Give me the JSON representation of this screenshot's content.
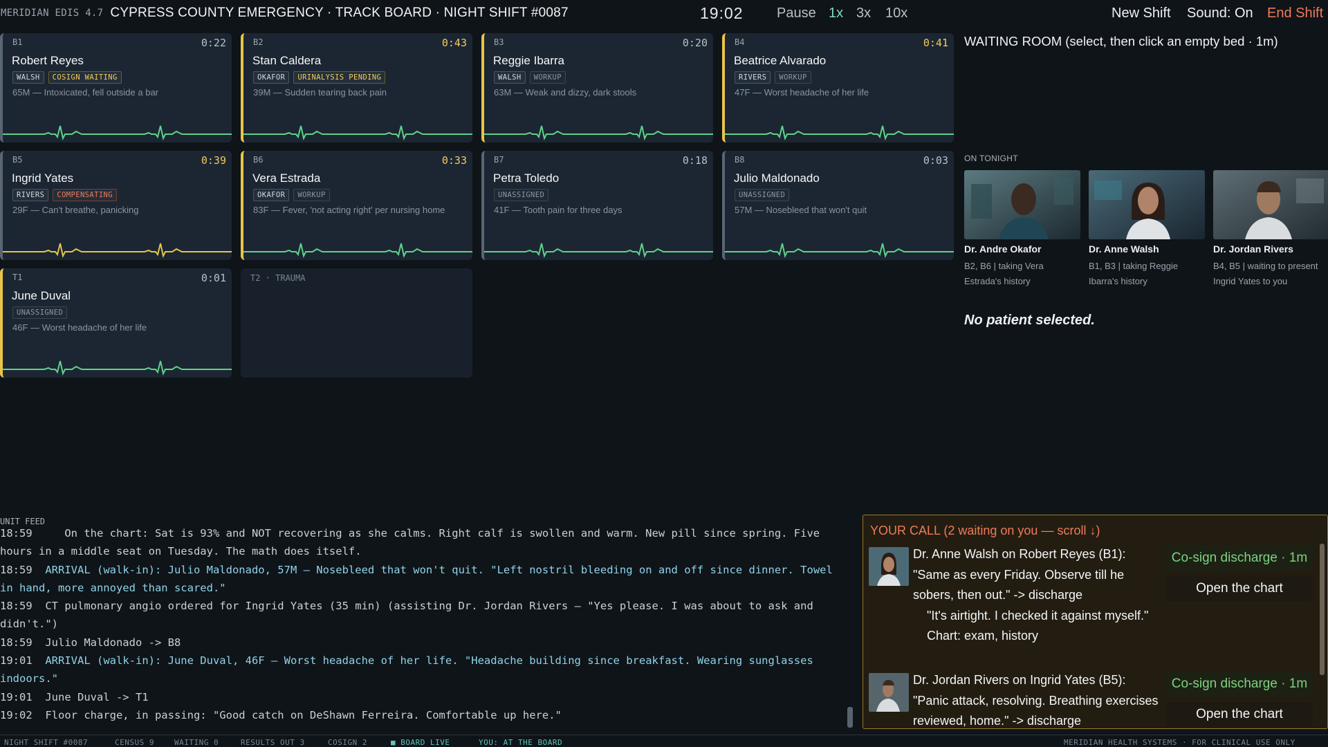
{
  "topbar": {
    "brand": "MERIDIAN EDIS 4.7",
    "title": "CYPRESS COUNTY EMERGENCY · TRACK BOARD · NIGHT SHIFT #0087",
    "clock": "19:02",
    "pause": "Pause",
    "speed_1x": "1x",
    "speed_3x": "3x",
    "speed_10x": "10x",
    "active_speed": "1x",
    "new_shift": "New Shift",
    "sound": "Sound: On",
    "end_shift": "End Shift"
  },
  "beds": [
    {
      "id": "B1",
      "timer": "0:22",
      "timer_warn": false,
      "accent": "#5a6573",
      "name": "Robert Reyes",
      "tags": [
        {
          "text": "WALSH",
          "style": "plain"
        },
        {
          "text": "COSIGN WAITING",
          "style": "amber"
        }
      ],
      "complaint": "65M — Intoxicated, fell outside a bar",
      "ekg": "#5fd38a"
    },
    {
      "id": "B2",
      "timer": "0:43",
      "timer_warn": true,
      "accent": "#e8c548",
      "name": "Stan Caldera",
      "tags": [
        {
          "text": "OKAFOR",
          "style": "plain"
        },
        {
          "text": "URINALYSIS PENDING",
          "style": "amber"
        }
      ],
      "complaint": "39M — Sudden tearing back pain",
      "ekg": "#5fd38a"
    },
    {
      "id": "B3",
      "timer": "0:20",
      "timer_warn": false,
      "accent": "#e8c548",
      "name": "Reggie Ibarra",
      "tags": [
        {
          "text": "WALSH",
          "style": "plain"
        },
        {
          "text": "WORKUP",
          "style": "muted"
        }
      ],
      "complaint": "63M — Weak and dizzy, dark stools",
      "ekg": "#5fd38a"
    },
    {
      "id": "B4",
      "timer": "0:41",
      "timer_warn": true,
      "accent": "#e8c548",
      "name": "Beatrice Alvarado",
      "tags": [
        {
          "text": "RIVERS",
          "style": "plain"
        },
        {
          "text": "WORKUP",
          "style": "muted"
        }
      ],
      "complaint": "47F — Worst headache of her life",
      "ekg": "#5fd38a"
    },
    {
      "id": "B5",
      "timer": "0:39",
      "timer_warn": true,
      "accent": "#5a6573",
      "name": "Ingrid Yates",
      "tags": [
        {
          "text": "RIVERS",
          "style": "plain"
        },
        {
          "text": "COMPENSATING",
          "style": "orange"
        }
      ],
      "complaint": "29F — Can't breathe, panicking",
      "ekg": "#e8c548"
    },
    {
      "id": "B6",
      "timer": "0:33",
      "timer_warn": true,
      "accent": "#e8c548",
      "name": "Vera Estrada",
      "tags": [
        {
          "text": "OKAFOR",
          "style": "plain"
        },
        {
          "text": "WORKUP",
          "style": "muted"
        }
      ],
      "complaint": "83F — Fever, 'not acting right' per nursing home",
      "ekg": "#5fd38a"
    },
    {
      "id": "B7",
      "timer": "0:18",
      "timer_warn": false,
      "accent": "#5a6573",
      "name": "Petra Toledo",
      "tags": [
        {
          "text": "UNASSIGNED",
          "style": "muted"
        }
      ],
      "complaint": "41F — Tooth pain for three days",
      "ekg": "#5fd38a"
    },
    {
      "id": "B8",
      "timer": "0:03",
      "timer_warn": false,
      "accent": "#5a6573",
      "name": "Julio Maldonado",
      "tags": [
        {
          "text": "UNASSIGNED",
          "style": "muted"
        }
      ],
      "complaint": "57M — Nosebleed that won't quit",
      "ekg": "#5fd38a"
    },
    {
      "id": "T1",
      "timer": "0:01",
      "timer_warn": false,
      "accent": "#e8c548",
      "name": "June Duval",
      "tags": [
        {
          "text": "UNASSIGNED",
          "style": "muted"
        }
      ],
      "complaint": "46F — Worst headache of her life",
      "ekg": "#5fd38a"
    }
  ],
  "empty_bed": {
    "label": "T2 · TRAUMA"
  },
  "waiting_room": {
    "title": "WAITING ROOM  (select, then click an empty bed · 1m)"
  },
  "on_tonight": {
    "label": "ON TONIGHT",
    "staff": [
      {
        "name": "Dr. Andre Okafor",
        "status": "B2, B6 | taking Vera Estrada's history"
      },
      {
        "name": "Dr. Anne Walsh",
        "status": "B1, B3 | taking Reggie Ibarra's history"
      },
      {
        "name": "Dr. Jordan Rivers",
        "status": "B4, B5 | waiting to present Ingrid Yates to you"
      }
    ]
  },
  "selection": {
    "empty_text": "No patient selected."
  },
  "feed": {
    "label": "UNIT FEED",
    "lines": [
      {
        "text": "18:59     On the chart: Sat is 93% and NOT recovering as she calms. Right calf is swollen and warm. New pill since spring. Five hours in a middle seat on Tuesday. The math does itself.",
        "arrival": false
      },
      {
        "time": "18:59",
        "text": "ARRIVAL (walk-in): Julio Maldonado, 57M — Nosebleed that won't quit. \"Left nostril bleeding on and off since dinner. Towel in hand, more annoyed than scared.\"",
        "arrival": true
      },
      {
        "text": "18:59  CT pulmonary angio ordered for Ingrid Yates (35 min) (assisting Dr. Jordan Rivers — \"Yes please. I was about to ask and didn't.\")",
        "arrival": false
      },
      {
        "text": "18:59  Julio Maldonado -> B8",
        "arrival": false
      },
      {
        "time": "19:01",
        "text": "ARRIVAL (walk-in): June Duval, 46F — Worst headache of her life. \"Headache building since breakfast. Wearing sunglasses indoors.\"",
        "arrival": true
      },
      {
        "text": "19:01  June Duval -> T1",
        "arrival": false
      },
      {
        "text": "19:02  Floor charge, in passing: \"Good catch on DeShawn Ferreira. Comfortable up here.\"",
        "arrival": false
      }
    ]
  },
  "your_call": {
    "title": "YOUR CALL  (2 waiting on you — scroll ↓)",
    "items": [
      {
        "header": "Dr. Anne Walsh on Robert Reyes (B1):",
        "quote": "\"Same as every Friday. Observe till he sobers, then out.\" -> discharge",
        "note": "\"It's airtight. I checked it against myself.\"",
        "chart": "Chart: exam, history",
        "cosign": "Co-sign discharge · 1m",
        "open": "Open the chart"
      },
      {
        "header": "Dr. Jordan Rivers on Ingrid Yates (B5):",
        "quote": "\"Panic attack, resolving. Breathing exercises reviewed, home.\" -> discharge",
        "cosign": "Co-sign discharge · 1m",
        "open": "Open the chart"
      }
    ]
  },
  "statusbar": {
    "shift": "NIGHT SHIFT #0087",
    "census": "CENSUS 9",
    "waiting": "WAITING 0",
    "results": "RESULTS OUT 3",
    "cosign": "COSIGN 2",
    "live": "■ BOARD LIVE",
    "you": "YOU: AT THE BOARD",
    "vendor": "MERIDIAN HEALTH SYSTEMS · FOR CLINICAL USE ONLY"
  }
}
